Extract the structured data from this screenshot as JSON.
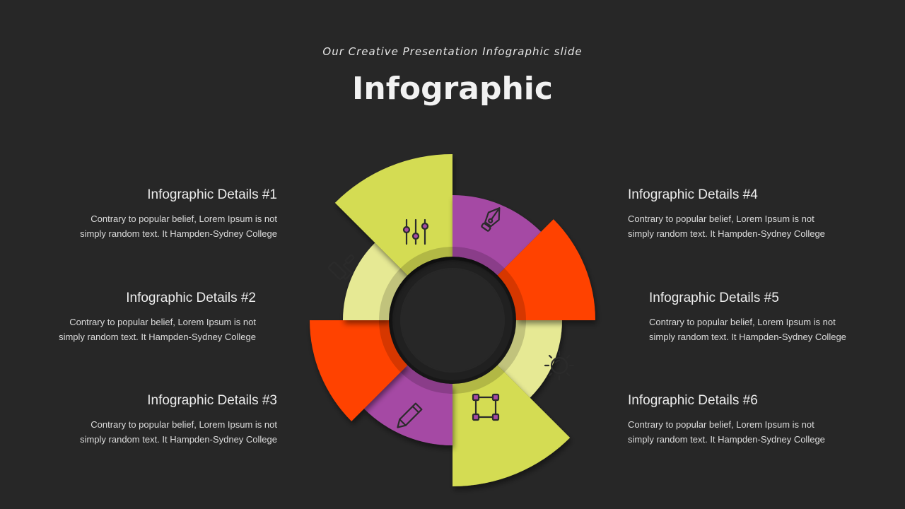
{
  "header": {
    "subtitle": "Our Creative Presentation Infographic slide",
    "title": "Infographic"
  },
  "colors": {
    "background": "#272727",
    "lime": "#d4dc52",
    "pale_lime": "#e6e994",
    "purple": "#a54aa4",
    "orange": "#ff4200",
    "icon_stroke": "#2b2b2b"
  },
  "items": [
    {
      "title": "Infographic Details #1",
      "text_line1": "Contrary to popular belief, Lorem Ipsum is not",
      "text_line2": "simply random text. It Hampden-Sydney College"
    },
    {
      "title": "Infographic Details #2",
      "text_line1": "Contrary to popular belief, Lorem Ipsum is not",
      "text_line2": "simply random text. It Hampden-Sydney College"
    },
    {
      "title": "Infographic Details #3",
      "text_line1": "Contrary to popular belief, Lorem Ipsum is not",
      "text_line2": "simply random text. It Hampden-Sydney College"
    },
    {
      "title": "Infographic Details #4",
      "text_line1": "Contrary to popular belief, Lorem Ipsum is not",
      "text_line2": "simply random text. It Hampden-Sydney College"
    },
    {
      "title": "Infographic Details #5",
      "text_line1": "Contrary to popular belief, Lorem Ipsum is not",
      "text_line2": "simply random text. It Hampden-Sydney College"
    },
    {
      "title": "Infographic Details #6",
      "text_line1": "Contrary to popular belief, Lorem Ipsum is not",
      "text_line2": "simply random text. It Hampden-Sydney College"
    }
  ],
  "segments": [
    {
      "name": "segment-pale-right",
      "color": "pale_lime",
      "icon": ""
    },
    {
      "name": "segment-lime-bottom-right",
      "color": "lime",
      "icon": "sun-icon"
    },
    {
      "name": "segment-purple-bottom",
      "color": "purple",
      "icon": "vector-square-icon"
    },
    {
      "name": "segment-orange-bottom",
      "color": "orange",
      "icon": "pencil-icon"
    },
    {
      "name": "segment-pale-left",
      "color": "pale_lime",
      "icon": ""
    },
    {
      "name": "segment-lime-left",
      "color": "lime",
      "icon": "paint-roller-icon"
    },
    {
      "name": "segment-purple-top",
      "color": "purple",
      "icon": "sliders-icon"
    },
    {
      "name": "segment-orange-top",
      "color": "orange",
      "icon": "pen-nib-icon"
    }
  ]
}
